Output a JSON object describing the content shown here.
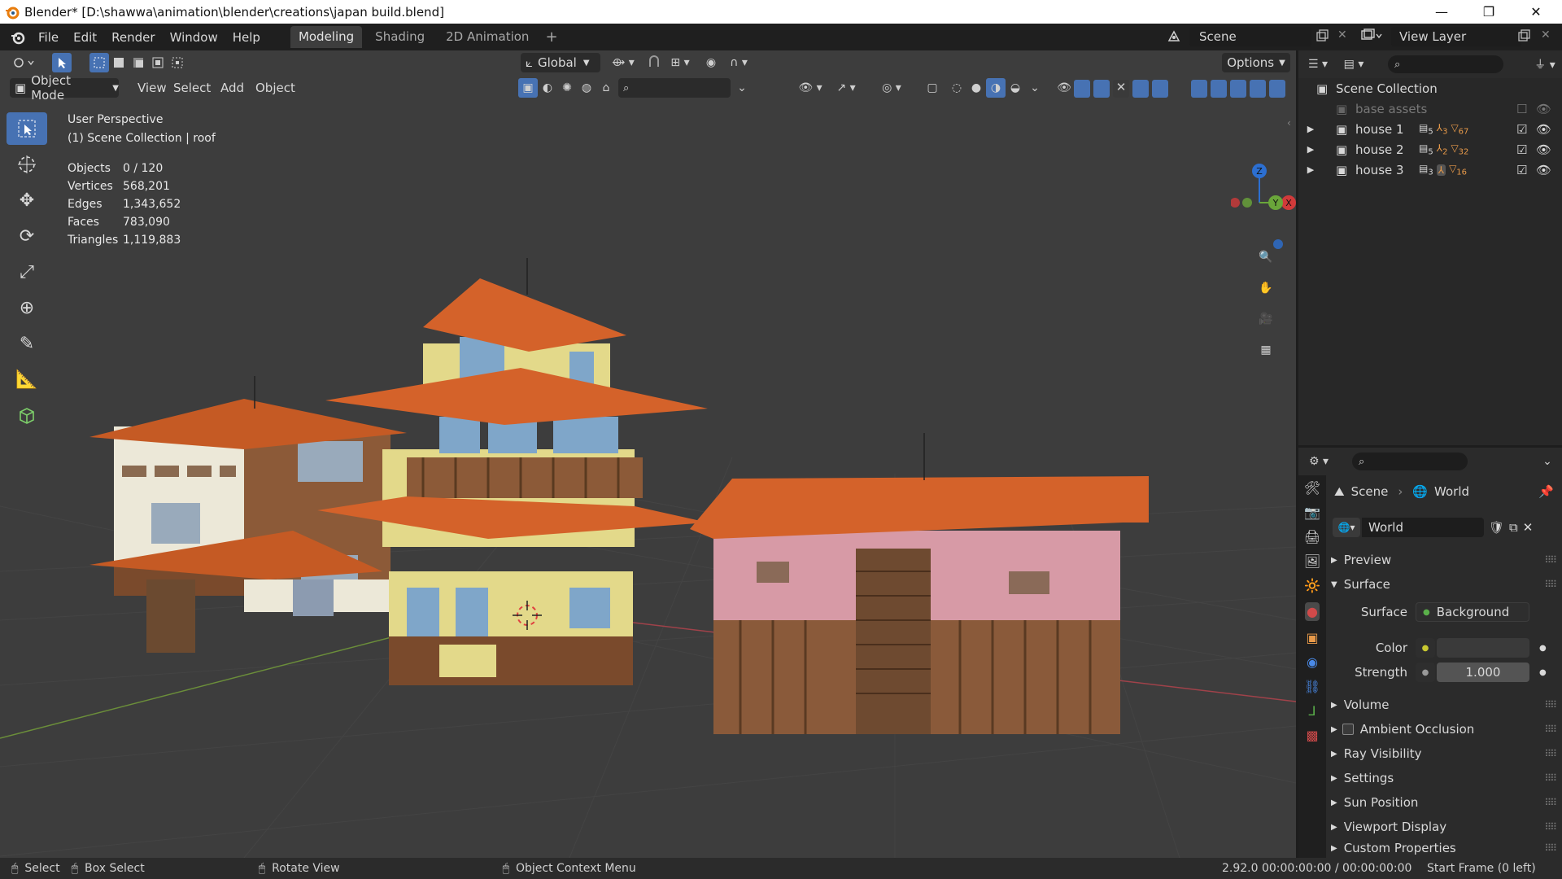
{
  "titlebar": {
    "title": "Blender* [D:\\shawwa\\animation\\blender\\creations\\japan build.blend]",
    "minimize": "—",
    "restore": "❐",
    "close": "✕"
  },
  "menu": [
    "File",
    "Edit",
    "Render",
    "Window",
    "Help"
  ],
  "workspaces": [
    "Modeling",
    "Shading",
    "2D Animation"
  ],
  "active_workspace": "Modeling",
  "add_workspace": "+",
  "scene_selector": {
    "label": "Scene"
  },
  "view_layer": {
    "label": "View Layer"
  },
  "viewport_header": {
    "transform_orientation": "Global",
    "options": "Options",
    "mode": "Object Mode",
    "menus": [
      "View",
      "Select",
      "Add",
      "Object"
    ]
  },
  "overlay": {
    "perspective": "User Perspective",
    "collection": "(1) Scene Collection | roof"
  },
  "stats": [
    {
      "label": "Objects",
      "value": "0 / 120"
    },
    {
      "label": "Vertices",
      "value": "568,201"
    },
    {
      "label": "Edges",
      "value": "1,343,652"
    },
    {
      "label": "Faces",
      "value": "783,090"
    },
    {
      "label": "Triangles",
      "value": "1,119,883"
    }
  ],
  "gizmo_axes": {
    "z": "Z",
    "x": "X",
    "y": "Y"
  },
  "outliner": {
    "root": "Scene Collection",
    "items": [
      {
        "name": "base assets",
        "dim": true,
        "counts": []
      },
      {
        "name": "house 1",
        "dim": false,
        "counts": [
          "5",
          "3",
          "67"
        ]
      },
      {
        "name": "house 2",
        "dim": false,
        "counts": [
          "5",
          "2",
          "32"
        ]
      },
      {
        "name": "house 3",
        "dim": false,
        "counts": [
          "3",
          "",
          "16"
        ]
      }
    ]
  },
  "properties": {
    "breadcrumb_scene": "Scene",
    "breadcrumb_world": "World",
    "world_name": "World",
    "panels_top": [
      "Preview",
      "Surface"
    ],
    "surface_label": "Surface",
    "surface_value": "Background",
    "color_label": "Color",
    "strength_label": "Strength",
    "strength_value": "1.000",
    "panels_bottom": [
      "Volume",
      "Ambient Occlusion",
      "Ray Visibility",
      "Settings",
      "Sun Position",
      "Viewport Display",
      "Custom Properties"
    ]
  },
  "statusbar": {
    "select": "Select",
    "box_select": "Box Select",
    "rotate_view": "Rotate View",
    "context_menu": "Object Context Menu",
    "info": "2.92.0  00:00:00:00 / 00:00:00:00",
    "frame": "Start Frame (0 left)"
  },
  "colors": {
    "accent": "#4772b3",
    "roof": "#d4622a",
    "wall_yellow": "#e3d98a",
    "wall_pink": "#d79aa6",
    "window_blue": "#7fa6c9",
    "wood": "#7a4a2c",
    "grid": "#3d3d3d"
  }
}
